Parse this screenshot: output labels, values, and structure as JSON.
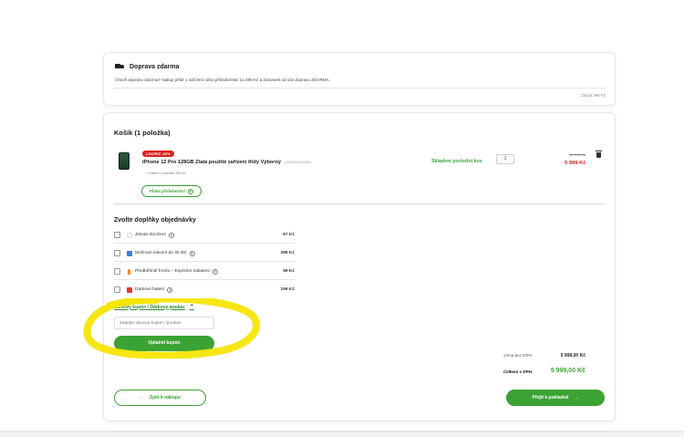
{
  "shipping": {
    "title": "Doprava zdarma",
    "message": "Chceš dopravu zdarma? Nakup ještě 1 zařízení nebo příslušenství za 495 Kč a dostaneš od nás dopravu ZDARMA.",
    "remaining": "Zbývá 495 Kč"
  },
  "cart": {
    "title": "Košík (1 položka)",
    "item": {
      "badge": "LOUPEŽ -60%",
      "name": "iPhone 12 Pro 128GB Zlatá použité zařízení třídy Výborný",
      "code": "(0520037431650)",
      "gift": "+ Dárek v hodnotě 285 Kč",
      "stock": "Skladem poslední kus",
      "quantity": "1",
      "old_price": "14 990 Kč",
      "new_price": "5 999 Kč"
    },
    "add_accessory": "Přidat příslušenství",
    "addons_title": "Zvolte doplňky objednávky",
    "addons": [
      {
        "label": "Jistota doručení",
        "price": "67 Kč",
        "icon": "shield-icon",
        "icon_color": "#cfcfcf"
      },
      {
        "label": "Možnost vrácení do 30 dní",
        "price": "399 Kč",
        "icon": "return-icon",
        "icon_color": "#3b7fd8"
      },
      {
        "label": "Předběhnití frontu – Expresní zabalení",
        "price": "59 Kč",
        "icon": "fire-icon",
        "icon_color": "#f28c1e"
      },
      {
        "label": "Dárkové balení",
        "price": "199 Kč",
        "icon": "gift-icon",
        "icon_color": "#e03a2c"
      }
    ],
    "coupon": {
      "toggle": "Slevový kupón / Dárkový poukaz",
      "placeholder": "Zadejte slevový kupón / poukaz",
      "apply": "Uplatnit kupón"
    },
    "summary": {
      "without_vat_label": "Cena bez DPH",
      "without_vat_value": "5 999,00 Kč",
      "total_label": "Celkem s DPH",
      "total_value": "5 999,00 Kč"
    },
    "back_label": "Zpět k nákupu",
    "checkout_label": "Přejít k pokladně"
  },
  "colors": {
    "accent": "#3aa334",
    "sale": "#e02020",
    "highlight": "#f5e400"
  }
}
